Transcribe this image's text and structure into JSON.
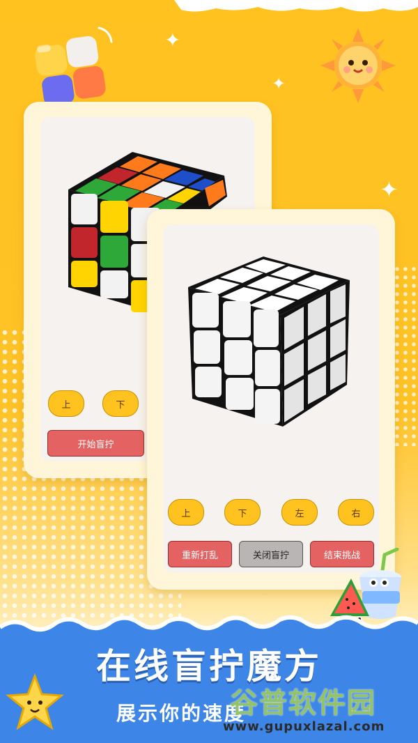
{
  "back_card": {
    "buttons": {
      "up": "上",
      "down": "下",
      "start": "开始盲拧"
    }
  },
  "front_card": {
    "direction_buttons": [
      "上",
      "下",
      "左",
      "右"
    ],
    "action_buttons": {
      "rescramble": "重新打乱",
      "close_blind": "关闭盲拧",
      "end_challenge": "结束挑战"
    }
  },
  "banner": {
    "title": "在线盲拧魔方",
    "subtitle": "展示你的速度"
  },
  "watermark": {
    "brand": "谷普软件园",
    "url": "www.gupuxlazal.com"
  },
  "colors": {
    "accent": "#ffc21f",
    "button_red": "#e56262",
    "button_gray": "#b9b5b4",
    "banner_blue": "#3d86e8"
  }
}
